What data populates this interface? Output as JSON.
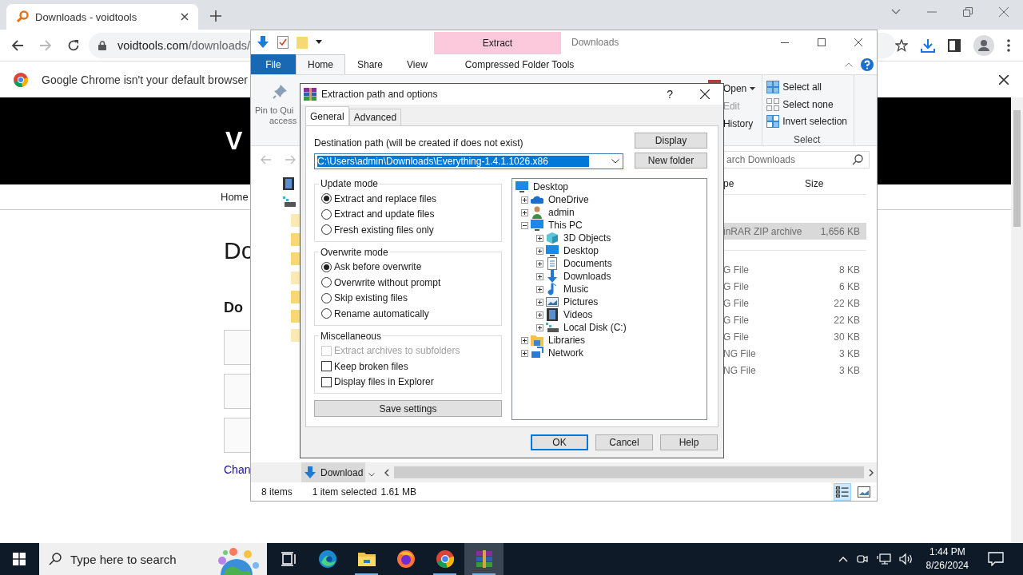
{
  "browser": {
    "tab": {
      "title": "Downloads - voidtools"
    },
    "address": {
      "host": "voidtools.com",
      "path": "/downloads/"
    },
    "infobar": "Google Chrome isn't your default browser",
    "page": {
      "banner": "V",
      "nav": "Home",
      "heading": "Do",
      "subheading": "Do",
      "link": "Chan"
    }
  },
  "explorer": {
    "title": "Downloads",
    "context_tab": "Extract",
    "tabs": [
      {
        "label": "File",
        "kind": "file",
        "selected": false
      },
      {
        "label": "Home",
        "kind": "tab",
        "selected": true
      },
      {
        "label": "Share",
        "kind": "tab",
        "selected": false
      },
      {
        "label": "View",
        "kind": "tab",
        "selected": false
      },
      {
        "label": "Compressed Folder Tools",
        "kind": "context",
        "selected": false
      }
    ],
    "ribbon": {
      "pin_label": [
        "Pin to Qui",
        "access"
      ],
      "open_group": [
        {
          "label": "Open",
          "kind": "menu",
          "disabled": false
        },
        {
          "label": "Edit",
          "kind": "plain",
          "disabled": true
        },
        {
          "label": "History",
          "kind": "plain",
          "disabled": false
        }
      ],
      "select_group": {
        "label": "Select",
        "items": [
          {
            "label": "Select all",
            "kind": "all"
          },
          {
            "label": "Select none",
            "kind": "none"
          },
          {
            "label": "Invert selection",
            "kind": "invert"
          }
        ]
      }
    },
    "search": {
      "placeholder": "arch Downloads"
    },
    "columns": [
      "pe",
      "Size"
    ],
    "groups": [
      {
        "rows": [
          {
            "type": "inRAR ZIP archive",
            "size": "1,656 KB",
            "selected": true
          }
        ]
      },
      {
        "rows": [
          {
            "type": "G File",
            "size": "8 KB",
            "selected": false
          },
          {
            "type": "G File",
            "size": "6 KB",
            "selected": false
          },
          {
            "type": "G File",
            "size": "22 KB",
            "selected": false
          },
          {
            "type": "G File",
            "size": "22 KB",
            "selected": false
          },
          {
            "type": "G File",
            "size": "30 KB",
            "selected": false
          },
          {
            "type": "NG File",
            "size": "3 KB",
            "selected": false
          },
          {
            "type": "NG File",
            "size": "3 KB",
            "selected": false
          }
        ]
      }
    ],
    "nav_item": "Download",
    "status": {
      "count": "8 items",
      "selection": "1 item selected",
      "size": "1.61 MB"
    }
  },
  "dialog": {
    "title": "Extraction path and options",
    "help": "?",
    "tabs": [
      {
        "label": "General",
        "selected": true
      },
      {
        "label": "Advanced",
        "selected": false
      }
    ],
    "destination": {
      "label": "Destination path (will be created if does not exist)",
      "value": "C:\\Users\\admin\\Downloads\\Everything-1.4.1.1026.x86",
      "selected": true
    },
    "side_buttons": [
      "Display",
      "New folder"
    ],
    "update_mode": {
      "label": "Update mode",
      "options": [
        {
          "label": "Extract and replace files",
          "selected": true
        },
        {
          "label": "Extract and update files",
          "selected": false
        },
        {
          "label": "Fresh existing files only",
          "selected": false
        }
      ]
    },
    "overwrite_mode": {
      "label": "Overwrite mode",
      "options": [
        {
          "label": "Ask before overwrite",
          "selected": true
        },
        {
          "label": "Overwrite without prompt",
          "selected": false
        },
        {
          "label": "Skip existing files",
          "selected": false
        },
        {
          "label": "Rename automatically",
          "selected": false
        }
      ]
    },
    "misc": {
      "label": "Miscellaneous",
      "options": [
        {
          "label": "Extract archives to subfolders",
          "checked": false,
          "disabled": true
        },
        {
          "label": "Keep broken files",
          "checked": false,
          "disabled": false
        },
        {
          "label": "Display files in Explorer",
          "checked": false,
          "disabled": false
        }
      ]
    },
    "save_button": "Save settings",
    "tree": {
      "label": "Desktop",
      "kind": "monitor",
      "children": [
        {
          "label": "OneDrive",
          "kind": "cloud",
          "expanded": false
        },
        {
          "label": "admin",
          "kind": "user",
          "expanded": false
        },
        {
          "label": "This PC",
          "kind": "monitor",
          "expanded": true,
          "children": [
            {
              "label": "3D Objects",
              "kind": "cube",
              "expanded": false
            },
            {
              "label": "Desktop",
              "kind": "monitor",
              "expanded": false
            },
            {
              "label": "Documents",
              "kind": "document",
              "expanded": false
            },
            {
              "label": "Downloads",
              "kind": "download",
              "expanded": false
            },
            {
              "label": "Music",
              "kind": "music",
              "expanded": false
            },
            {
              "label": "Pictures",
              "kind": "picture",
              "expanded": false
            },
            {
              "label": "Videos",
              "kind": "film",
              "expanded": false
            },
            {
              "label": "Local Disk (C:)",
              "kind": "disk",
              "expanded": false
            }
          ]
        },
        {
          "label": "Libraries",
          "kind": "library",
          "expanded": false
        },
        {
          "label": "Network",
          "kind": "network",
          "expanded": false
        }
      ]
    },
    "buttons": [
      {
        "label": "OK",
        "default": true
      },
      {
        "label": "Cancel",
        "default": false
      },
      {
        "label": "Help",
        "default": false
      }
    ]
  },
  "taskbar": {
    "search_placeholder": "Type here to search",
    "apps": [
      {
        "kind": "taskview",
        "running": false,
        "selected": false
      },
      {
        "kind": "edge",
        "running": false,
        "selected": false
      },
      {
        "kind": "explorer",
        "running": true,
        "selected": false
      },
      {
        "kind": "firefox",
        "running": false,
        "selected": false
      },
      {
        "kind": "chrome",
        "running": true,
        "selected": false
      },
      {
        "kind": "winrar",
        "running": true,
        "selected": true
      }
    ],
    "time": "1:44 PM",
    "date": "8/26/2024"
  }
}
